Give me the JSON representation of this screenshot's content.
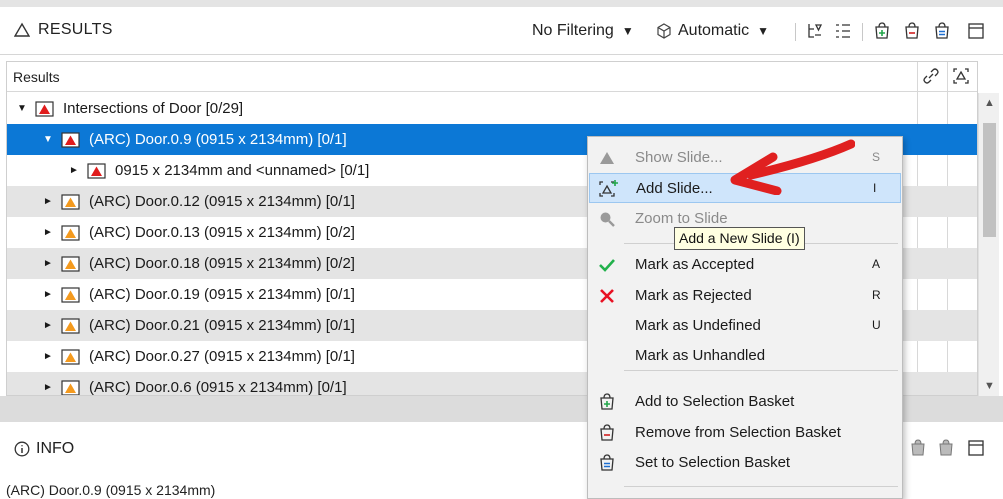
{
  "header": {
    "title": "RESULTS",
    "filtering_label": "No Filtering",
    "mode_label": "Automatic"
  },
  "results": {
    "column_header": "Results",
    "rows": [
      {
        "label": "Intersections of Door [0/29]",
        "level": 0,
        "expanded": true,
        "style": "normal",
        "icon": "door-red-icon"
      },
      {
        "label": "(ARC) Door.0.9 (0915 x 2134mm) [0/1]",
        "level": 1,
        "expanded": true,
        "style": "selected",
        "icon": "door-red-icon"
      },
      {
        "label": "0915 x 2134mm and <unnamed> [0/1]",
        "level": 2,
        "expanded": false,
        "style": "normal",
        "icon": "door-red-icon"
      },
      {
        "label": "(ARC) Door.0.12 (0915 x 2134mm) [0/1]",
        "level": 1,
        "expanded": false,
        "style": "alt",
        "icon": "door-orange-icon"
      },
      {
        "label": "(ARC) Door.0.13 (0915 x 2134mm) [0/2]",
        "level": 1,
        "expanded": false,
        "style": "normal",
        "icon": "door-orange-icon"
      },
      {
        "label": "(ARC) Door.0.18 (0915 x 2134mm) [0/2]",
        "level": 1,
        "expanded": false,
        "style": "alt",
        "icon": "door-orange-icon"
      },
      {
        "label": "(ARC) Door.0.19 (0915 x 2134mm) [0/1]",
        "level": 1,
        "expanded": false,
        "style": "normal",
        "icon": "door-orange-icon"
      },
      {
        "label": "(ARC) Door.0.21 (0915 x 2134mm) [0/1]",
        "level": 1,
        "expanded": false,
        "style": "alt",
        "icon": "door-orange-icon"
      },
      {
        "label": "(ARC) Door.0.27 (0915 x 2134mm) [0/1]",
        "level": 1,
        "expanded": false,
        "style": "normal",
        "icon": "door-orange-icon"
      },
      {
        "label": "(ARC) Door.0.6 (0915 x 2134mm) [0/1]",
        "level": 1,
        "expanded": false,
        "style": "alt",
        "icon": "door-orange-icon"
      }
    ]
  },
  "info": {
    "title": "INFO",
    "text": "(ARC) Door.0.9 (0915 x 2134mm)"
  },
  "context_menu": {
    "items": [
      {
        "label": "Show Slide...",
        "key": "S",
        "icon": "triangle-icon",
        "disabled": true
      },
      {
        "label": "Add Slide...",
        "key": "I",
        "icon": "add-slide-icon",
        "highlighted": true
      },
      {
        "label": "Zoom to Slide",
        "key": "",
        "icon": "magnifier-icon",
        "disabled": true
      },
      {
        "label": "Mark as Accepted",
        "key": "A",
        "icon": "check-icon"
      },
      {
        "label": "Mark as Rejected",
        "key": "R",
        "icon": "cross-icon"
      },
      {
        "label": "Mark as Undefined",
        "key": "U",
        "icon": ""
      },
      {
        "label": "Mark as Unhandled",
        "key": "",
        "icon": ""
      },
      {
        "label": "Add to Selection Basket",
        "key": "",
        "icon": "basket-add-icon"
      },
      {
        "label": "Remove from Selection Basket",
        "key": "",
        "icon": "basket-remove-icon"
      },
      {
        "label": "Set to Selection Basket",
        "key": "",
        "icon": "basket-set-icon"
      }
    ]
  },
  "tooltip": {
    "text": "Add a New Slide (I)"
  },
  "colors": {
    "selection": "#0c78d6",
    "menu_highlight": "#cfe5fb",
    "accept": "#22b14c",
    "reject": "#e81123",
    "annotation_arrow": "#e02020"
  }
}
